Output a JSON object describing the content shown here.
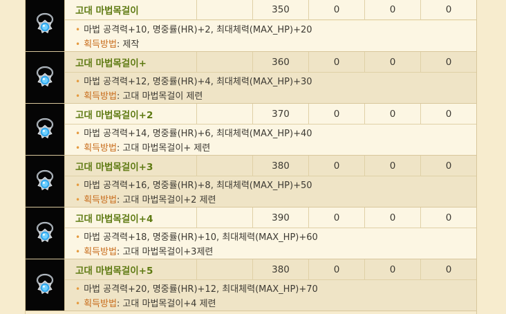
{
  "items": [
    {
      "name": "고대 마법목걸이",
      "level": "350",
      "v1": "0",
      "v2": "0",
      "v3": "0",
      "stats": "마법 공격력+10, 명중률(HR)+2, 최대체력(MAX_HP)+20",
      "acq_label": "획득방법",
      "acq_value": ": 제작"
    },
    {
      "name": "고대 마법목걸이+",
      "level": "360",
      "v1": "0",
      "v2": "0",
      "v3": "0",
      "stats": "마법 공격력+12, 명중률(HR)+4, 최대체력(MAX_HP)+30",
      "acq_label": "획득방법",
      "acq_value": ": 고대 마법목걸이 제련"
    },
    {
      "name": "고대 마법목걸이+2",
      "level": "370",
      "v1": "0",
      "v2": "0",
      "v3": "0",
      "stats": "마법 공격력+14, 명중률(HR)+6, 최대체력(MAX_HP)+40",
      "acq_label": "획득방법",
      "acq_value": ": 고대 마법목걸이+ 제련"
    },
    {
      "name": "고대 마법목걸이+3",
      "level": "380",
      "v1": "0",
      "v2": "0",
      "v3": "0",
      "stats": "마법 공격력+16, 명중률(HR)+8, 최대체력(MAX_HP)+50",
      "acq_label": "획득방법",
      "acq_value": ": 고대 마법목걸이+2 제련"
    },
    {
      "name": "고대 마법목걸이+4",
      "level": "390",
      "v1": "0",
      "v2": "0",
      "v3": "0",
      "stats": "마법 공격력+18, 명중률(HR)+10, 최대체력(MAX_HP)+60",
      "acq_label": "획득방법",
      "acq_value": ": 고대 마법목걸이+3제련"
    },
    {
      "name": "고대 마법목걸이+5",
      "level": "380",
      "v1": "0",
      "v2": "0",
      "v3": "0",
      "stats": "마법 공격력+20, 명중률(HR)+12, 최대체력(MAX_HP)+70",
      "acq_label": "획득방법",
      "acq_value": ": 고대 마법목걸이+4 제련"
    }
  ],
  "bullet": "•",
  "icon_name": "blue-gem-necklace-icon"
}
